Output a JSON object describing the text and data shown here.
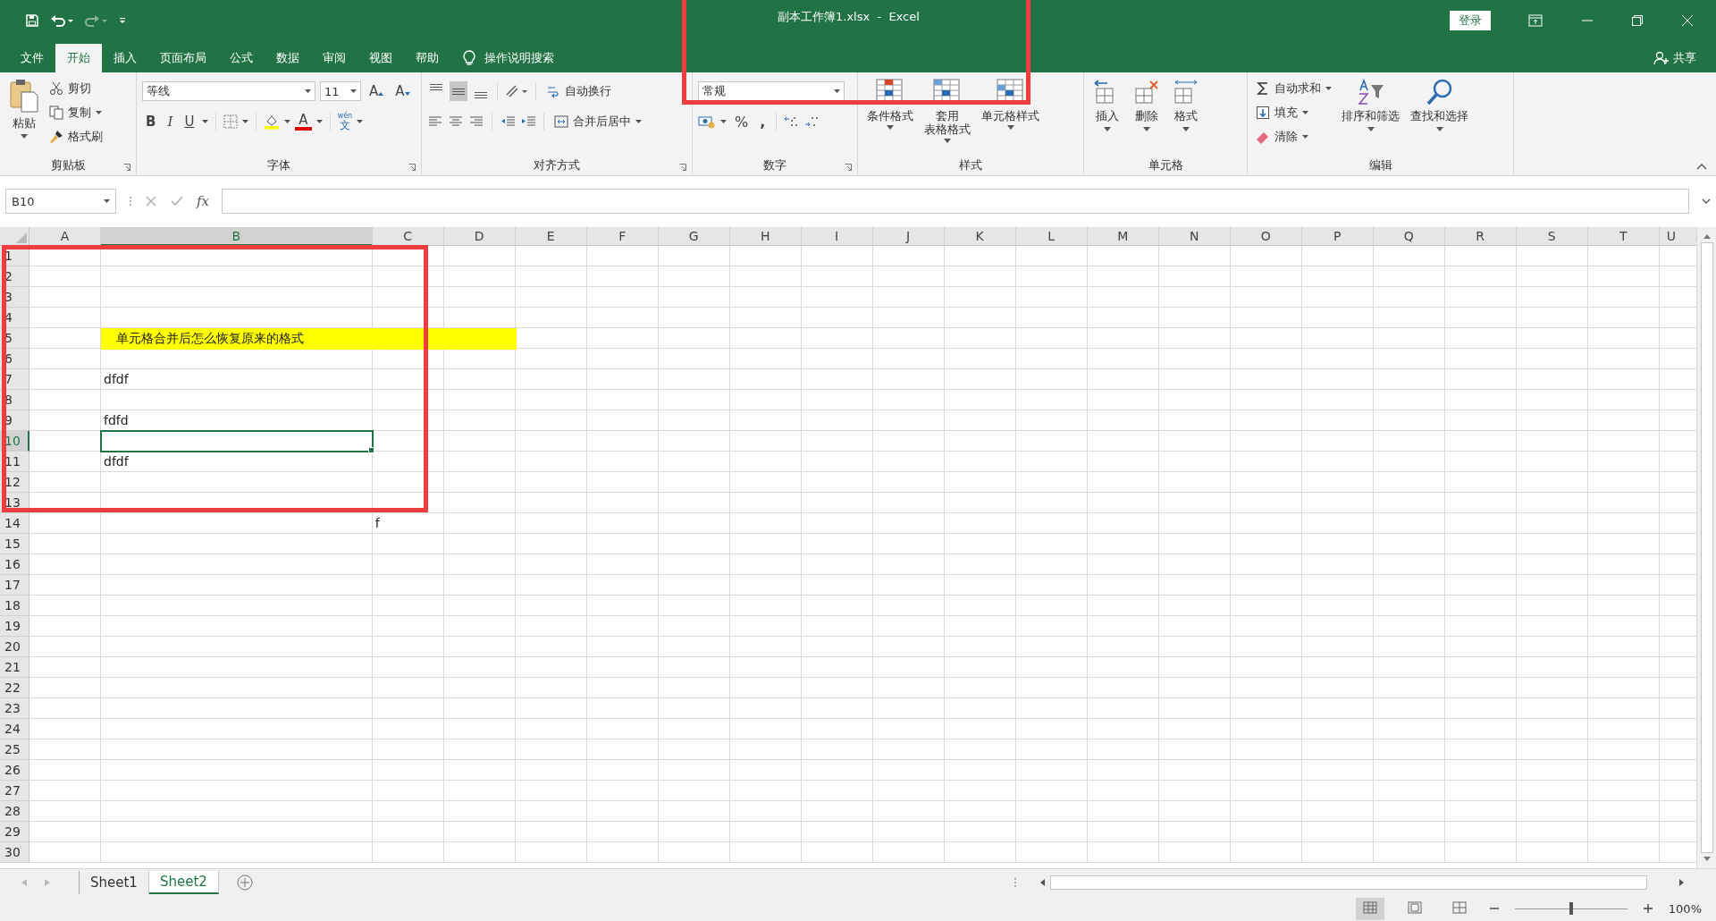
{
  "window": {
    "title": "副本工作簿1.xlsx  -  Excel",
    "login": "登录",
    "share": "共享"
  },
  "tabs": [
    {
      "label": "文件",
      "selected": false
    },
    {
      "label": "开始",
      "selected": true
    },
    {
      "label": "插入",
      "selected": false
    },
    {
      "label": "页面布局",
      "selected": false
    },
    {
      "label": "公式",
      "selected": false
    },
    {
      "label": "数据",
      "selected": false
    },
    {
      "label": "审阅",
      "selected": false
    },
    {
      "label": "视图",
      "selected": false
    },
    {
      "label": "帮助",
      "selected": false
    }
  ],
  "tell_me": {
    "placeholder": "操作说明搜索"
  },
  "ribbon": [
    {
      "kind": "clipboard",
      "label": "剪贴板",
      "paste": "粘贴",
      "small": [
        {
          "label": "剪切",
          "dropdown": false
        },
        {
          "label": "复制",
          "dropdown": true
        },
        {
          "label": "格式刷",
          "dropdown": false
        }
      ]
    },
    {
      "kind": "font",
      "label": "字体",
      "font": "等线",
      "size": "11",
      "grow": "A",
      "shrink": "A",
      "styles": [
        "B",
        "I",
        "U"
      ],
      "color_glyph": "A",
      "phonetic": "文",
      "phonetic_ruby": "wén"
    },
    {
      "kind": "alignment",
      "label": "对齐方式",
      "vertical": [
        {
          "selected": false
        },
        {
          "selected": true
        },
        {
          "selected": false
        }
      ],
      "wrap": "自动换行",
      "merge": "合并后居中"
    },
    {
      "kind": "number",
      "label": "数字",
      "format": "常规",
      "percent": "%",
      "comma": ","
    },
    {
      "kind": "styles",
      "label": "样式",
      "commands": [
        {
          "lines": [
            "条件格式"
          ]
        },
        {
          "lines": [
            "套用",
            "表格格式"
          ]
        },
        {
          "lines": [
            "单元格样式"
          ]
        }
      ]
    },
    {
      "kind": "cells",
      "label": "单元格",
      "commands": [
        "插入",
        "删除",
        "格式"
      ]
    },
    {
      "kind": "editing",
      "label": "编辑",
      "small": [
        {
          "label": "自动求和",
          "dropdown": true
        },
        {
          "label": "填充",
          "dropdown": true
        },
        {
          "label": "清除",
          "dropdown": true
        }
      ],
      "large": [
        "排序和筛选",
        "查找和选择"
      ]
    }
  ],
  "formula_bar": {
    "name_box": "B10",
    "fx": "fx"
  },
  "columns": [
    {
      "label": "A",
      "selected": false
    },
    {
      "label": "B",
      "selected": true
    },
    {
      "label": "C",
      "selected": false
    },
    {
      "label": "D",
      "selected": false
    },
    {
      "label": "E",
      "selected": false
    },
    {
      "label": "F",
      "selected": false
    },
    {
      "label": "G",
      "selected": false
    },
    {
      "label": "H",
      "selected": false
    },
    {
      "label": "I",
      "selected": false
    },
    {
      "label": "J",
      "selected": false
    },
    {
      "label": "K",
      "selected": false
    },
    {
      "label": "L",
      "selected": false
    },
    {
      "label": "M",
      "selected": false
    },
    {
      "label": "N",
      "selected": false
    },
    {
      "label": "O",
      "selected": false
    },
    {
      "label": "P",
      "selected": false
    },
    {
      "label": "Q",
      "selected": false
    },
    {
      "label": "R",
      "selected": false
    },
    {
      "label": "S",
      "selected": false
    },
    {
      "label": "T",
      "selected": false
    },
    {
      "label": "U",
      "selected": false
    }
  ],
  "rows": [
    {
      "label": "1",
      "selected": false,
      "cells": {}
    },
    {
      "label": "2",
      "selected": false,
      "cells": {}
    },
    {
      "label": "3",
      "selected": false,
      "cells": {}
    },
    {
      "label": "4",
      "selected": false,
      "cells": {}
    },
    {
      "label": "5",
      "selected": false,
      "cells": {
        "B": {
          "text": "单元格合并后怎么恢复原来的格式",
          "highlighted": true,
          "selected": false
        },
        "C": {
          "highlighted": true,
          "selected": false
        },
        "D": {
          "highlighted": true,
          "selected": false
        }
      }
    },
    {
      "label": "6",
      "selected": false,
      "cells": {}
    },
    {
      "label": "7",
      "selected": false,
      "cells": {
        "B": {
          "text": "dfdf",
          "highlighted": false,
          "selected": false
        }
      }
    },
    {
      "label": "8",
      "selected": false,
      "cells": {}
    },
    {
      "label": "9",
      "selected": false,
      "cells": {
        "B": {
          "text": "fdfd",
          "highlighted": false,
          "selected": false
        }
      }
    },
    {
      "label": "10",
      "selected": true,
      "cells": {
        "B": {
          "highlighted": false,
          "selected": true
        }
      }
    },
    {
      "label": "11",
      "selected": false,
      "cells": {
        "B": {
          "text": "dfdf",
          "highlighted": false,
          "selected": false
        }
      }
    },
    {
      "label": "12",
      "selected": false,
      "cells": {}
    },
    {
      "label": "13",
      "selected": false,
      "cells": {}
    },
    {
      "label": "14",
      "selected": false,
      "cells": {
        "C": {
          "text": "f",
          "highlighted": false,
          "selected": false
        }
      }
    },
    {
      "label": "15",
      "selected": false,
      "cells": {}
    },
    {
      "label": "16",
      "selected": false,
      "cells": {}
    },
    {
      "label": "17",
      "selected": false,
      "cells": {}
    },
    {
      "label": "18",
      "selected": false,
      "cells": {}
    },
    {
      "label": "19",
      "selected": false,
      "cells": {}
    },
    {
      "label": "20",
      "selected": false,
      "cells": {}
    },
    {
      "label": "21",
      "selected": false,
      "cells": {}
    },
    {
      "label": "22",
      "selected": false,
      "cells": {}
    },
    {
      "label": "23",
      "selected": false,
      "cells": {}
    },
    {
      "label": "24",
      "selected": false,
      "cells": {}
    },
    {
      "label": "25",
      "selected": false,
      "cells": {}
    },
    {
      "label": "26",
      "selected": false,
      "cells": {}
    },
    {
      "label": "27",
      "selected": false,
      "cells": {}
    },
    {
      "label": "28",
      "selected": false,
      "cells": {}
    },
    {
      "label": "29",
      "selected": false,
      "cells": {}
    },
    {
      "label": "30",
      "selected": false,
      "cells": {}
    }
  ],
  "sheets": [
    {
      "label": "Sheet1",
      "selected": false
    },
    {
      "label": "Sheet2",
      "selected": true
    }
  ],
  "status_bar": {
    "views": [
      {
        "selected": true
      },
      {
        "selected": false
      },
      {
        "selected": false
      }
    ],
    "zoom": {
      "level": 0.5,
      "reading": "100%"
    }
  },
  "annotations": [
    {
      "color": "#f03c3c"
    },
    {
      "color": "#f03c3c"
    }
  ]
}
